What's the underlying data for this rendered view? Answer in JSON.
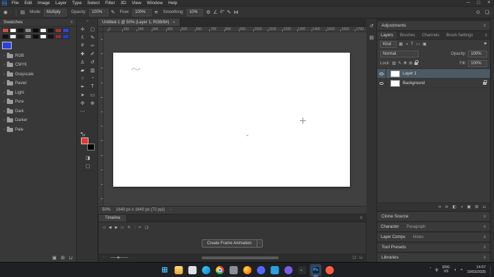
{
  "app": {
    "title_icon": "Ps",
    "menu_items": [
      "File",
      "Edit",
      "Image",
      "Layer",
      "Type",
      "Select",
      "Filter",
      "3D",
      "View",
      "Window",
      "Help"
    ],
    "window_controls": {
      "minimize": "—",
      "maximize": "▢",
      "close": "✕"
    }
  },
  "icons": {
    "caret_down": "ˇ",
    "chevron_right": "›",
    "menu": "≡",
    "collapse": "»",
    "brush_preset": "◉",
    "panel_toggle": "▤",
    "pen_pressure": "✎",
    "airbrush": "≋",
    "gear": "⚙",
    "angle": "∠",
    "symmetry": "⋈",
    "search": "⊙",
    "workspace": "❏",
    "mask_mode": "◨",
    "screen_mode": "▢",
    "chevron_up": "ˆ",
    "mic": "ψ",
    "volume": "◖",
    "network": "≈"
  },
  "options_bar": {
    "mode_label": "Mode:",
    "mode_value": "Multiply",
    "opacity_label": "Opacity:",
    "opacity_value": "100%",
    "flow_label": "Flow:",
    "flow_value": "100%",
    "smoothing_label": "Smoothing:",
    "smoothing_value": "10%",
    "angle_value": "0°"
  },
  "swatches": {
    "title": "Swatches",
    "row1": [
      "#c94f4f",
      "#ffffff",
      "#141414",
      "#8a8a8a",
      "#0a0a0a",
      "#f2f2f2",
      "#101010",
      "#9e3535",
      "#2a49d8"
    ],
    "row2": [
      "#101010",
      "#ededed",
      "#1d1d1d",
      "#767676",
      "#0d0d0d",
      "#fafafa",
      "#151515",
      "#8c2f2f",
      "#2140c8"
    ],
    "selected_swatch_color": "#2742e0",
    "groups": [
      "RGB",
      "CMYK",
      "Grayscale",
      "Pastel",
      "Light",
      "Pure",
      "Dark",
      "Darker",
      "Pale"
    ],
    "footer_icons": [
      {
        "name": "new-group-icon",
        "glyph": "▣"
      },
      {
        "name": "new-swatch-icon",
        "glyph": "⊞"
      },
      {
        "name": "delete-swatch-icon",
        "glyph": "⊔"
      }
    ]
  },
  "toolbar": {
    "tools": [
      {
        "name": "move-tool",
        "glyph": "✛"
      },
      {
        "name": "marquee-tool",
        "glyph": "▢"
      },
      {
        "name": "lasso-tool",
        "glyph": "ς"
      },
      {
        "name": "quick-select-tool",
        "glyph": "✎"
      },
      {
        "name": "crop-tool",
        "glyph": "#"
      },
      {
        "name": "eyedropper-tool",
        "glyph": "✑"
      },
      {
        "name": "healing-tool",
        "glyph": "✚"
      },
      {
        "name": "brush-tool",
        "glyph": "✐"
      },
      {
        "name": "stamp-tool",
        "glyph": "♙"
      },
      {
        "name": "history-brush-tool",
        "glyph": "↺"
      },
      {
        "name": "eraser-tool",
        "glyph": "▰"
      },
      {
        "name": "gradient-tool",
        "glyph": "▥"
      },
      {
        "name": "blur-tool",
        "glyph": "○"
      },
      {
        "name": "dodge-tool",
        "glyph": "◔"
      },
      {
        "name": "pen-tool",
        "glyph": "✒"
      },
      {
        "name": "type-tool",
        "glyph": "T"
      },
      {
        "name": "path-select-tool",
        "glyph": "➤"
      },
      {
        "name": "shape-tool",
        "glyph": "▭"
      },
      {
        "name": "hand-tool",
        "glyph": "✣"
      },
      {
        "name": "zoom-tool",
        "glyph": "⊕"
      },
      {
        "name": "edit-toolbar",
        "glyph": "⋯"
      }
    ],
    "foreground_color": "#e8382c",
    "background_color": "#000000"
  },
  "document": {
    "tab_title": "Untitled-1 @ 50% (Layer 1, RGB/8#)",
    "tab_close": "✕",
    "ruler_labels": [
      "0",
      "100",
      "200",
      "300",
      "400",
      "500",
      "600",
      "700",
      "800",
      "900",
      "1000",
      "1100",
      "1200",
      "1300",
      "1400",
      "1500",
      "1600",
      "1700"
    ],
    "status_zoom": "50%",
    "status_info": "1640 px x 1640 px (72 ppi)"
  },
  "timeline": {
    "title": "Timeline",
    "transport": [
      {
        "name": "first-frame-icon",
        "glyph": "◁"
      },
      {
        "name": "prev-frame-icon",
        "glyph": "◀"
      },
      {
        "name": "play-icon",
        "glyph": "▶"
      },
      {
        "name": "next-frame-icon",
        "glyph": "▷"
      },
      {
        "name": "loop-icon",
        "glyph": "↻"
      },
      {
        "name": "tween-icon",
        "glyph": "✂"
      },
      {
        "name": "duplicate-frame-icon",
        "glyph": "❏"
      }
    ],
    "create_button": "Create Frame Animation"
  },
  "right_dock": {
    "collapsed_icons": [
      {
        "name": "history-panel-icon",
        "glyph": "↺"
      },
      {
        "name": "properties-panel-icon",
        "glyph": "▤"
      }
    ],
    "adjustments_title": "Adjustments",
    "layers": {
      "tabs": [
        "Layers",
        "Brushes",
        "Channels",
        "Brush Settings"
      ],
      "kind_value": "Kind",
      "filter_icons": [
        {
          "name": "filter-pixel-layers-icon",
          "glyph": "▦"
        },
        {
          "name": "filter-adjustment-layers-icon",
          "glyph": "◑"
        },
        {
          "name": "filter-type-layers-icon",
          "glyph": "T"
        },
        {
          "name": "filter-shape-layers-icon",
          "glyph": "▭"
        },
        {
          "name": "filter-smart-objects-icon",
          "glyph": "▣"
        }
      ],
      "filter_toggle_glyph": "⚑",
      "blend_mode": "Normal",
      "opacity_label": "Opacity:",
      "opacity_value": "100%",
      "lock_label": "Lock:",
      "lock_icons": [
        {
          "name": "lock-transparent-icon",
          "glyph": "▨"
        },
        {
          "name": "lock-pixels-icon",
          "glyph": "✎"
        },
        {
          "name": "lock-position-icon",
          "glyph": "✥"
        },
        {
          "name": "lock-artboard-icon",
          "glyph": "⊞"
        }
      ],
      "fill_label": "Fill:",
      "fill_value": "100%",
      "layers": [
        {
          "name": "Layer 1",
          "selected": true,
          "locked": false
        },
        {
          "name": "Background",
          "selected": false,
          "locked": true
        }
      ],
      "bottom_icons": [
        {
          "name": "link-layers-icon",
          "glyph": "∞"
        },
        {
          "name": "layer-effects-icon",
          "glyph": "fx"
        },
        {
          "name": "layer-mask-icon",
          "glyph": "◧"
        },
        {
          "name": "adjustment-layer-icon",
          "glyph": "◑"
        },
        {
          "name": "layer-group-icon",
          "glyph": "▣"
        },
        {
          "name": "new-layer-icon",
          "glyph": "⊞"
        },
        {
          "name": "delete-layer-icon",
          "glyph": "⊔"
        }
      ]
    },
    "clone_source_title": "Clone Source",
    "character_tabs": [
      "Character",
      "Paragraph"
    ],
    "layer_comps_tabs": [
      "Layer Comps",
      "Notes"
    ],
    "tool_presets_title": "Tool Presets",
    "libraries_title": "Libraries"
  },
  "taskbar": {
    "icons": [
      {
        "name": "start",
        "shape": "sq",
        "css_bg": "transparent",
        "glyph": "⊞",
        "glyph_color": "#4cc2ff",
        "glyph_size": 11
      },
      {
        "name": "file-explorer",
        "shape": "sq",
        "css_bg": "linear-gradient(180deg,#ffd97a,#e8a93c)"
      },
      {
        "name": "light-app",
        "shape": "sq",
        "css_bg": "#dfe3e8"
      },
      {
        "name": "edge",
        "shape": "circ",
        "css_bg": "linear-gradient(135deg,#35d2f2,#1b7fd4)"
      },
      {
        "name": "chrome",
        "shape": "circ",
        "css_bg": "radial-gradient(circle,#4285f4 0 2px,#ffffff 2px 3.2px,transparent 3.2px),conic-gradient(#ea4335 0 33%,#34a853 33% 66%,#fbbc05 66% 100%)"
      },
      {
        "name": "gray-app",
        "shape": "sq",
        "css_bg": "#8a8f98"
      },
      {
        "name": "firefox",
        "shape": "circ",
        "css_bg": "radial-gradient(circle at 35% 35%,#ffd54f,#ff8000 70%)"
      },
      {
        "name": "blue-app",
        "shape": "circ",
        "css_bg": "#5468ff"
      },
      {
        "name": "vscode",
        "shape": "sq",
        "css_bg": "#2aa0e0"
      },
      {
        "name": "purple-app",
        "shape": "circ",
        "css_bg": "#7b5ce0"
      },
      {
        "name": "terminal",
        "shape": "sq",
        "css_bg": "#2d2d2d",
        "glyph": ">_",
        "glyph_color": "#cccccc",
        "glyph_size": 4
      },
      {
        "name": "photoshop",
        "shape": "sq",
        "css_bg": "#0d2338",
        "border": "#2f6396",
        "glyph": "Ps",
        "glyph_color": "#4db8ff",
        "glyph_size": 6,
        "active": true
      },
      {
        "name": "red-app",
        "shape": "circ",
        "css_bg": "#ff5f3d"
      }
    ],
    "lang_line1": "ENG",
    "lang_line2": "US",
    "time": "14:57",
    "date": "19/03/2025"
  }
}
